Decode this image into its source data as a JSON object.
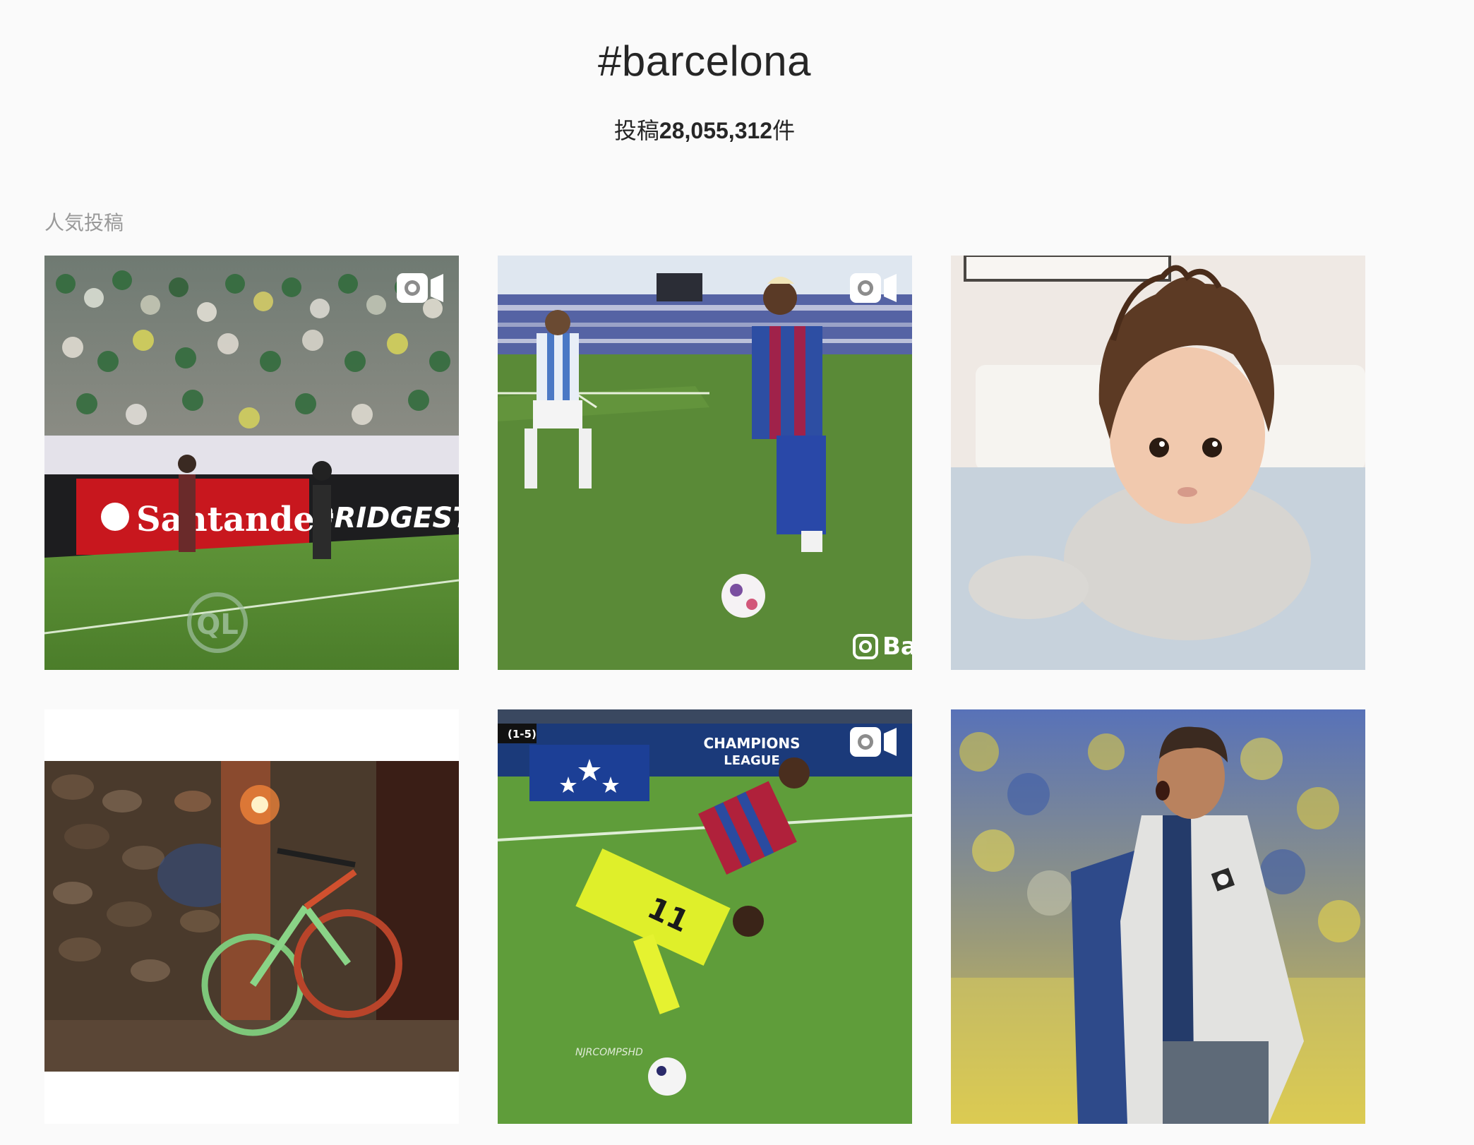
{
  "header": {
    "hashtag": "#barcelona",
    "count_prefix": "投稿",
    "count_value": "28,055,312",
    "count_suffix": "件"
  },
  "top_posts": {
    "label": "人気投稿",
    "posts": [
      {
        "type": "video",
        "icon": "video-camera-icon",
        "ad_text_1": "Santander",
        "ad_text_2": "BRIDGESTONE",
        "watermark": "QL"
      },
      {
        "type": "video",
        "icon": "video-camera-icon",
        "watermark": "Ba"
      },
      {
        "type": "image"
      },
      {
        "type": "image"
      },
      {
        "type": "video",
        "icon": "video-camera-icon",
        "banner_text_1": "CHAMPIONS",
        "banner_text_2": "LEAGUE",
        "score": "(1-5)",
        "watermark": "NJRCOMPSHD"
      },
      {
        "type": "image"
      }
    ]
  },
  "colors": {
    "background": "#fafafa",
    "text": "#262626",
    "muted": "#999999"
  }
}
